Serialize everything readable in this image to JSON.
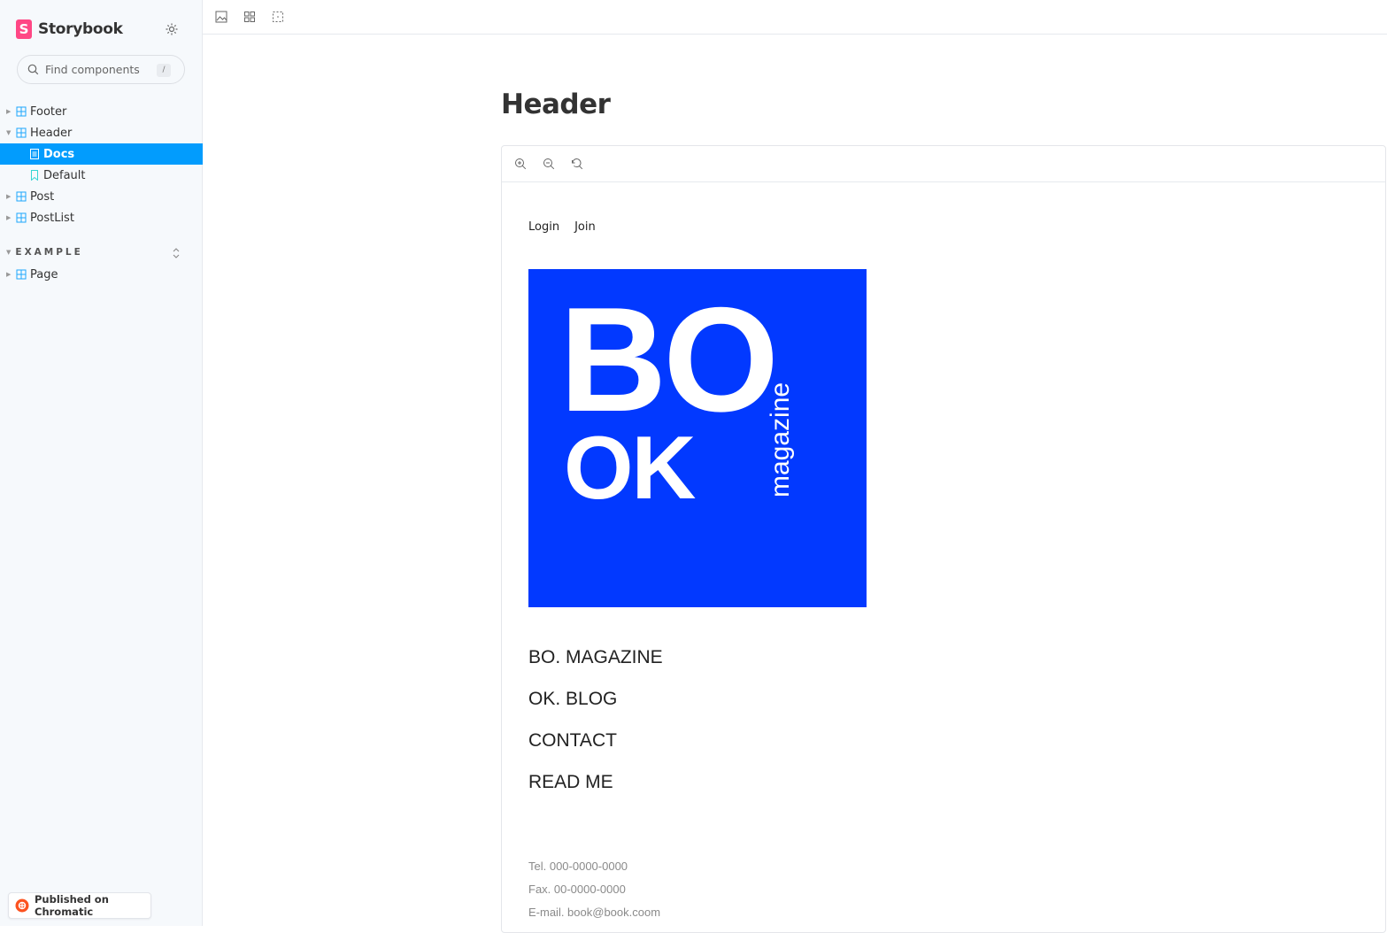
{
  "app": {
    "name": "Storybook"
  },
  "search": {
    "placeholder": "Find components",
    "shortcut": "/"
  },
  "sidebar": {
    "items": [
      {
        "label": "Footer"
      },
      {
        "label": "Header",
        "children": [
          {
            "label": "Docs"
          },
          {
            "label": "Default"
          }
        ]
      },
      {
        "label": "Post"
      },
      {
        "label": "PostList"
      }
    ],
    "section": {
      "title": "EXAMPLE",
      "items": [
        {
          "label": "Page"
        }
      ]
    }
  },
  "footer_badge": {
    "label": "Published on Chromatic"
  },
  "doc": {
    "title": "Header"
  },
  "header_component": {
    "auth": {
      "login": "Login",
      "join": "Join"
    },
    "logo": {
      "line1": "BO",
      "line2": "OK",
      "vertical": "magazine",
      "bg_color": "#0239ff"
    },
    "menu": [
      "BO. MAGAZINE",
      "OK. BLOG",
      "CONTACT",
      "READ ME"
    ],
    "contact": {
      "tel": "Tel. 000-0000-0000",
      "fax": "Fax. 00-0000-0000",
      "email": "E-mail. book@book.coom"
    }
  },
  "colors": {
    "accent": "#029cfd",
    "brand": "#ff4785"
  }
}
